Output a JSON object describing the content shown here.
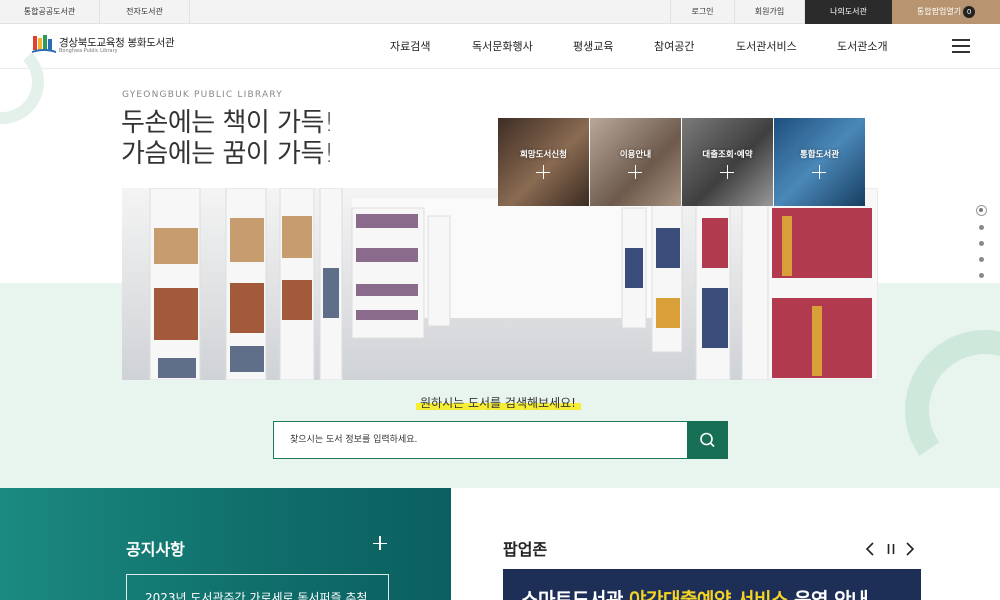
{
  "util": {
    "left": [
      "통합공공도서관",
      "전자도서관"
    ],
    "login": "로그인",
    "join": "회원가입",
    "mylib": "나의도서관",
    "popup": "통합팝업열기",
    "popup_count": "0"
  },
  "logo": {
    "title": "경상북도교육청 봉화도서관",
    "subtitle": "Bonghwa Public Library"
  },
  "nav": [
    "자료검색",
    "독서문화행사",
    "평생교육",
    "참여공간",
    "도서관서비스",
    "도서관소개"
  ],
  "hero": {
    "eyebrow": "GYEONGBUK PUBLIC LIBRARY",
    "line1": "두손에는 책이 가득!",
    "line2": "가슴에는 꿈이 가득!"
  },
  "quick_links": [
    "희망도서신청",
    "이용안내",
    "대출조회·예약",
    "통합도서관"
  ],
  "search": {
    "caption": "원하시는 도서를 검색해보세요!",
    "placeholder": "찾으시는 도서 정보를 입력하세요."
  },
  "notice": {
    "title": "공지사항",
    "item": "2023년 도서관주간 가로세로 독서퍼즐 추첨"
  },
  "popupzone": {
    "title": "팝업존",
    "banner_a": "스마트도서관 ",
    "banner_b": "야간대출예약 서비스",
    "banner_c": " 운영 안내"
  },
  "colors": {
    "accent": "#177055",
    "mint": "#e8f5ef",
    "notice": "#0f6d6a",
    "popup_btn": "#b89470"
  }
}
